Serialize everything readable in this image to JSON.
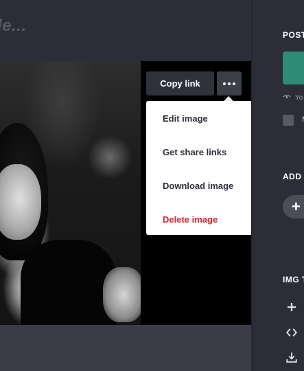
{
  "main": {
    "title_fragment": "le..."
  },
  "toolbar": {
    "copy_link_label": "Copy link"
  },
  "menu": {
    "items": [
      {
        "label": "Edit image"
      },
      {
        "label": "Get share links"
      },
      {
        "label": "Download image"
      },
      {
        "label": "Delete image"
      }
    ]
  },
  "sidebar": {
    "post_heading": "POST",
    "small_text": "Yo",
    "checkbox_label": "M",
    "add_heading": "ADD",
    "add_button_label": "+",
    "img_heading": "IMG T"
  },
  "colors": {
    "danger": "#e0212f",
    "thumbnail": "#2f8c74",
    "background": "#2b2e37"
  },
  "icons": [
    "more-dots-icon",
    "plus-icon",
    "code-icon",
    "download-icon",
    "eye-icon"
  ]
}
